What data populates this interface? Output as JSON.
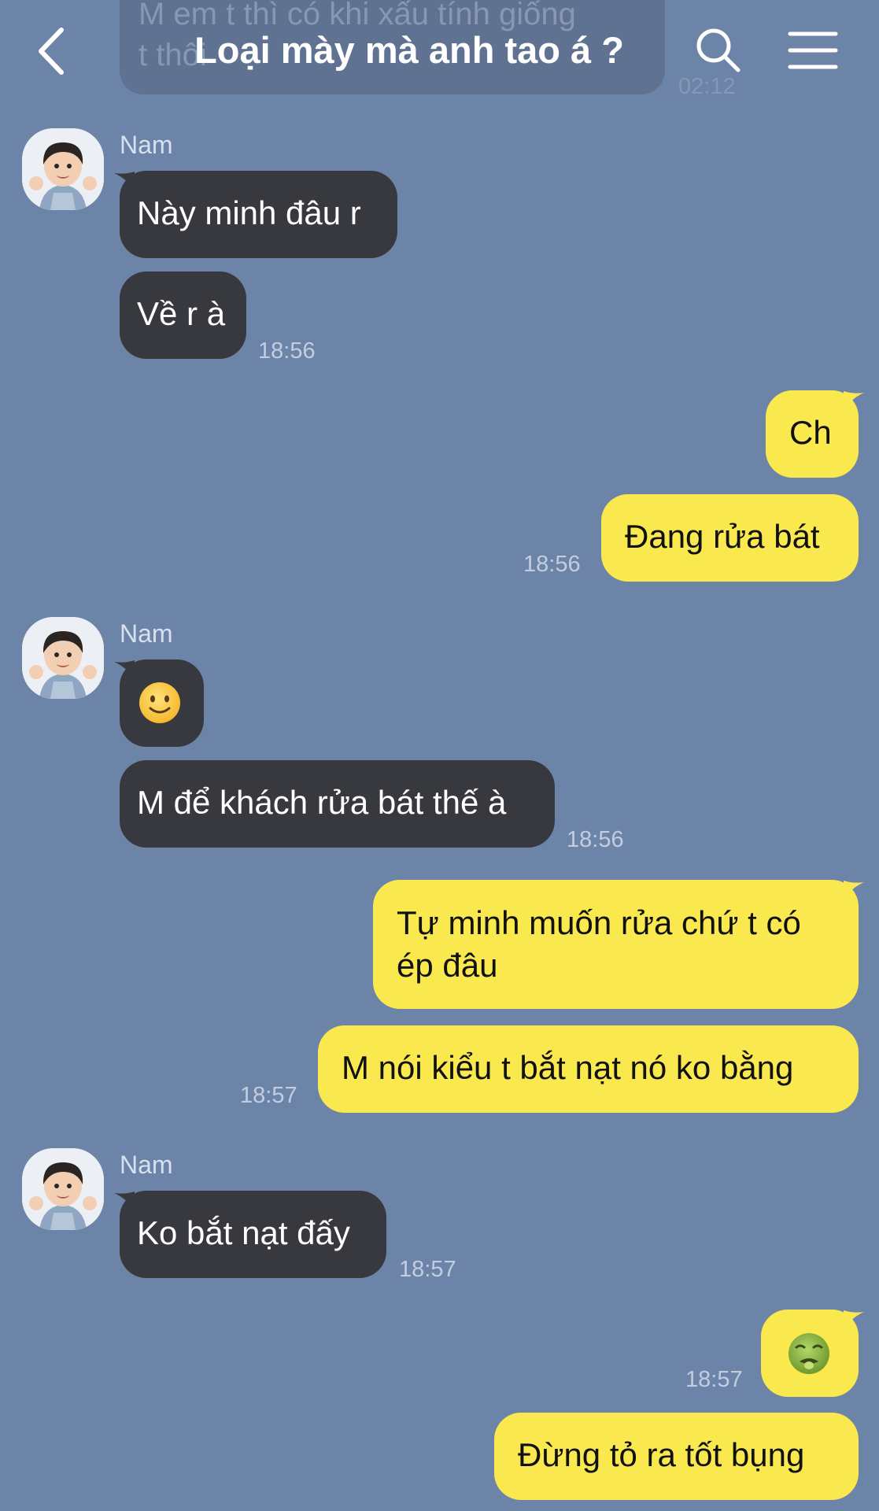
{
  "header": {
    "title": "Loại mày mà anh tao á ?",
    "back_icon": "chevron-left-icon",
    "search_icon": "search-icon",
    "menu_icon": "hamburger-menu-icon"
  },
  "faded_previous_message": {
    "text": "M em t thì có khi xấu tính giống\nt thôi",
    "time": "02:12"
  },
  "colors": {
    "background": "#6d84a9",
    "incoming_bubble": "#38393f",
    "outgoing_bubble": "#fae84f"
  },
  "messages": [
    {
      "id": "m1",
      "sender": "Nam",
      "direction": "incoming",
      "text": "Này minh đâu r"
    },
    {
      "id": "m2",
      "direction": "incoming",
      "text": "Về r à",
      "time": "18:56"
    },
    {
      "id": "m3",
      "direction": "outgoing",
      "text": "Ch"
    },
    {
      "id": "m4",
      "direction": "outgoing",
      "text": "Đang rửa bát",
      "time": "18:56"
    },
    {
      "id": "m5",
      "sender": "Nam",
      "direction": "incoming",
      "emoji": "slightly-smiling-face-emoji"
    },
    {
      "id": "m6",
      "direction": "incoming",
      "text": "M để khách rửa bát thế à",
      "time": "18:56"
    },
    {
      "id": "m7",
      "direction": "outgoing",
      "text": "Tự minh muốn rửa chứ t có ép đâu"
    },
    {
      "id": "m8",
      "direction": "outgoing",
      "text": "M nói kiểu t bắt nạt nó ko bằng",
      "time": "18:57"
    },
    {
      "id": "m9",
      "sender": "Nam",
      "direction": "incoming",
      "text": "Ko bắt nạt đấy",
      "time": "18:57"
    },
    {
      "id": "m10",
      "direction": "outgoing",
      "emoji": "nauseated-face-emoji",
      "time": "18:57"
    },
    {
      "id": "m11",
      "direction": "outgoing",
      "text": "Đừng tỏ ra tốt bụng"
    }
  ]
}
